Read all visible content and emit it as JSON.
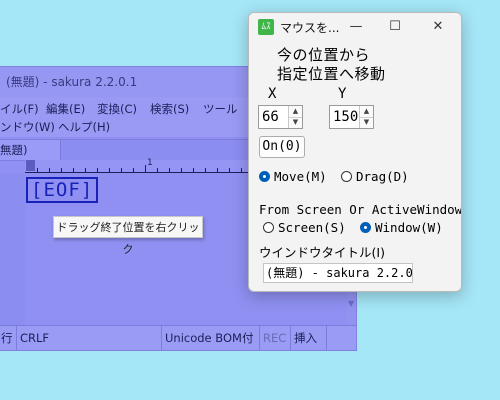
{
  "editor": {
    "title": "(無題) - sakura 2.2.0.1",
    "menu_row1": [
      "イル(F)",
      "編集(E)",
      "変換(C)",
      "検索(S)",
      "ツール"
    ],
    "menu_row2": [
      "ンドウ(W)",
      "ヘルプ(H)"
    ],
    "tab_label": "無題)",
    "ruler_number": "1",
    "eof_text": "[EOF]",
    "status": {
      "line_label": "行",
      "eol": "CRLF",
      "encoding": "Unicode BOM付",
      "rec": "REC",
      "mode": "挿入"
    }
  },
  "tooltip": {
    "text": "ドラッグ終了位置を右クリック"
  },
  "dialog": {
    "title": "マウスを...",
    "icon_text": "ﾑｽ",
    "minimize": "—",
    "maximize": "☐",
    "close": "✕",
    "heading_line1": "今の位置から",
    "heading_line2": "指定位置へ移動",
    "x_label": "X",
    "y_label": "Y",
    "x_value": "66",
    "y_value": "150",
    "on_button": "On(0)",
    "action_options": [
      {
        "label": "Move(M)",
        "selected": true
      },
      {
        "label": "Drag(D)",
        "selected": false
      }
    ],
    "from_label": "From Screen Or ActiveWindow",
    "from_options": [
      {
        "label": "Screen(S)",
        "selected": false
      },
      {
        "label": "Window(W)",
        "selected": true
      }
    ],
    "window_title_label": "ウインドウタイトル(I)",
    "window_title_value": "(無題) - sakura 2.2.0"
  },
  "colors": {
    "desktop": "#a5e6f7",
    "editor_overlay": "#8f90f2",
    "eof": "#1822b8",
    "app_icon": "#3fb54a",
    "radio_selected": "#005fb8"
  }
}
